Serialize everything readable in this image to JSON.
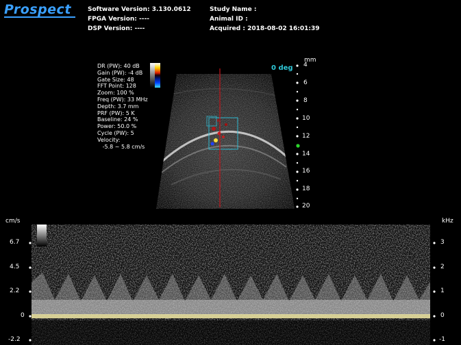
{
  "logo": "Prospect",
  "header": {
    "software_version": "Software Version: 3.130.0612",
    "fpga_version": "FPGA Version: ----",
    "dsp_version": "DSP Version: ----",
    "study_name": "Study Name :",
    "animal_id": "Animal ID :",
    "acquired": "Acquired : 2018-08-02 16:01:39"
  },
  "params": [
    "DR (PW): 40 dB",
    "Gain (PW): -4 dB",
    "Gate Size: 48",
    "FFT Point: 128",
    "Zoom: 100 %",
    "Freq (PW): 33 MHz",
    "Depth: 3.7 mm",
    "PRF (PW): 5 K",
    "Baseline: 24 %",
    "Power: 50.0 %",
    "Cycle (PW): 5",
    "Velocity:",
    "   -5.8 ~ 5.8 cm/s"
  ],
  "angle": "0 deg",
  "depth_scale": {
    "unit": "mm",
    "labels": [
      "4",
      "6",
      "8",
      "10",
      "12",
      "14",
      "16",
      "18",
      "20"
    ]
  },
  "doppler": {
    "velocity_unit": "cm/s",
    "velocity_labels": [
      "6.7",
      "4.5",
      "2.2",
      "0",
      "-2.2"
    ],
    "freq_unit": "kHz",
    "freq_labels": [
      "3",
      "2",
      "1",
      "0",
      "-1"
    ]
  },
  "colors": {
    "logo_blue": "#3aa0ff",
    "angle_cyan": "#2fc8d8",
    "gate_box": "#2fb8d0",
    "cursor_line": "#c0141a",
    "baseline_yellow": "#e8e0a0",
    "focus_marker": "#2bd62b"
  }
}
